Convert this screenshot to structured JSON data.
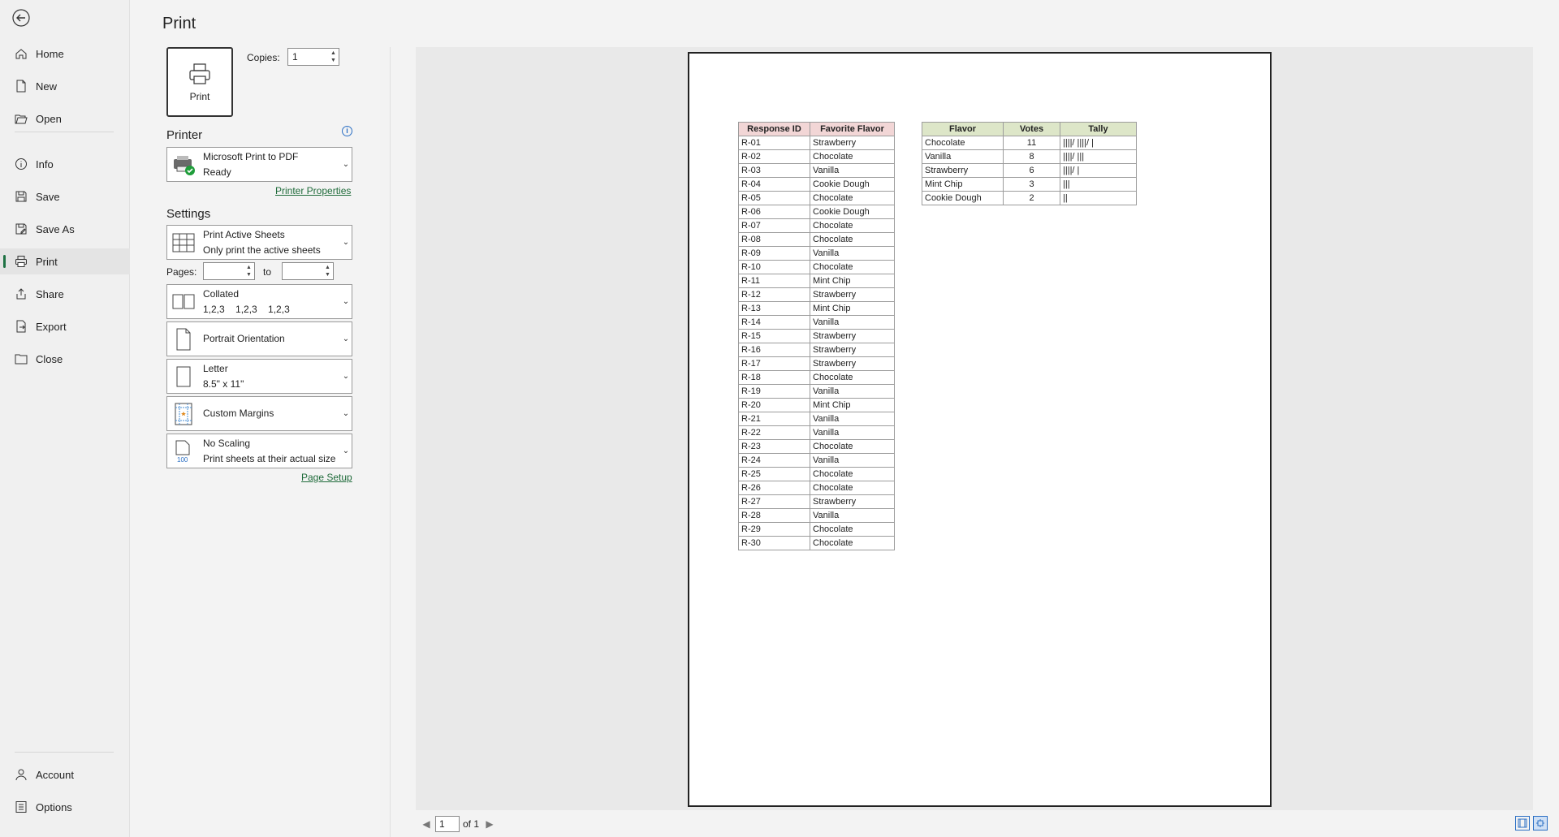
{
  "nav": {
    "items": [
      {
        "name": "home",
        "label": "Home",
        "icon": "home-icon"
      },
      {
        "name": "new",
        "label": "New",
        "icon": "new-document-icon"
      },
      {
        "name": "open",
        "label": "Open",
        "icon": "folder-open-icon"
      },
      {
        "name": "info",
        "label": "Info",
        "icon": "info-icon"
      },
      {
        "name": "save",
        "label": "Save",
        "icon": "save-icon"
      },
      {
        "name": "save-as",
        "label": "Save As",
        "icon": "save-as-icon"
      },
      {
        "name": "print",
        "label": "Print",
        "icon": "printer-icon",
        "active": true
      },
      {
        "name": "share",
        "label": "Share",
        "icon": "share-icon"
      },
      {
        "name": "export",
        "label": "Export",
        "icon": "export-icon"
      },
      {
        "name": "close",
        "label": "Close",
        "icon": "folder-close-icon"
      }
    ],
    "bottom": [
      {
        "name": "account",
        "label": "Account",
        "icon": "person-icon"
      },
      {
        "name": "options",
        "label": "Options",
        "icon": "options-icon"
      }
    ]
  },
  "title": "Print",
  "print_button": "Print",
  "copies": {
    "label": "Copies:",
    "value": "1"
  },
  "printer": {
    "heading": "Printer",
    "name": "Microsoft Print to PDF",
    "status": "Ready",
    "properties_link": "Printer Properties"
  },
  "settings": {
    "heading": "Settings",
    "what": {
      "title": "Print Active Sheets",
      "sub": "Only print the active sheets"
    },
    "pages_label": "Pages:",
    "to_label": "to",
    "collation": {
      "title": "Collated",
      "sub": "1,2,3    1,2,3    1,2,3"
    },
    "orientation": {
      "title": "Portrait Orientation"
    },
    "paper": {
      "title": "Letter",
      "sub": "8.5\" x 11\""
    },
    "margins": {
      "title": "Custom Margins"
    },
    "scaling": {
      "title": "No Scaling",
      "sub": "Print sheets at their actual size"
    },
    "page_setup_link": "Page Setup"
  },
  "sheet": {
    "responses": {
      "headers": [
        "Response ID",
        "Favorite Flavor"
      ],
      "rows": [
        [
          "R-01",
          "Strawberry"
        ],
        [
          "R-02",
          "Chocolate"
        ],
        [
          "R-03",
          "Vanilla"
        ],
        [
          "R-04",
          "Cookie Dough"
        ],
        [
          "R-05",
          "Chocolate"
        ],
        [
          "R-06",
          "Cookie Dough"
        ],
        [
          "R-07",
          "Chocolate"
        ],
        [
          "R-08",
          "Chocolate"
        ],
        [
          "R-09",
          "Vanilla"
        ],
        [
          "R-10",
          "Chocolate"
        ],
        [
          "R-11",
          "Mint Chip"
        ],
        [
          "R-12",
          "Strawberry"
        ],
        [
          "R-13",
          "Mint Chip"
        ],
        [
          "R-14",
          "Vanilla"
        ],
        [
          "R-15",
          "Strawberry"
        ],
        [
          "R-16",
          "Strawberry"
        ],
        [
          "R-17",
          "Strawberry"
        ],
        [
          "R-18",
          "Chocolate"
        ],
        [
          "R-19",
          "Vanilla"
        ],
        [
          "R-20",
          "Mint Chip"
        ],
        [
          "R-21",
          "Vanilla"
        ],
        [
          "R-22",
          "Vanilla"
        ],
        [
          "R-23",
          "Chocolate"
        ],
        [
          "R-24",
          "Vanilla"
        ],
        [
          "R-25",
          "Chocolate"
        ],
        [
          "R-26",
          "Chocolate"
        ],
        [
          "R-27",
          "Strawberry"
        ],
        [
          "R-28",
          "Vanilla"
        ],
        [
          "R-29",
          "Chocolate"
        ],
        [
          "R-30",
          "Chocolate"
        ]
      ]
    },
    "summary": {
      "headers": [
        "Flavor",
        "Votes",
        "Tally"
      ],
      "rows": [
        [
          "Chocolate",
          "11",
          "||||/ ||||/ |"
        ],
        [
          "Vanilla",
          "8",
          "||||/ |||"
        ],
        [
          "Strawberry",
          "6",
          "||||/ |"
        ],
        [
          "Mint Chip",
          "3",
          "|||"
        ],
        [
          "Cookie Dough",
          "2",
          "||"
        ]
      ]
    }
  },
  "pager": {
    "current": "1",
    "of": "of 1"
  },
  "colors": {
    "accent": "#1f7244",
    "link": "#1f6b3a"
  }
}
